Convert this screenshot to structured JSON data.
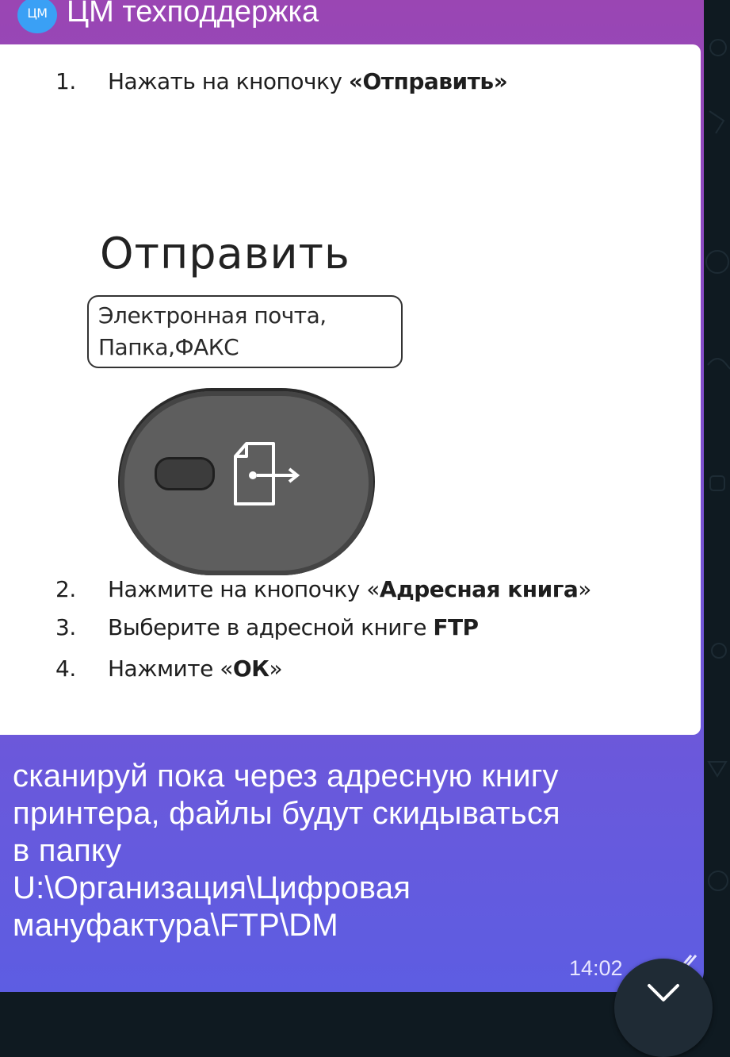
{
  "chat": {
    "sender_initials": "ЦМ",
    "sender_name": "ЦМ техподдержка"
  },
  "image": {
    "steps": [
      {
        "num": "1.",
        "text": "Нажать на кнопочку ",
        "bold": "«Отправить»"
      },
      {
        "num": "2.",
        "text": "Нажмите на кнопочку «",
        "bold": "Адресная книга",
        "tail": "»"
      },
      {
        "num": "3.",
        "text": "Выберите в адресной книге ",
        "bold": "FTP"
      },
      {
        "num": "4.",
        "text": "Нажмите «",
        "bold": "ОК",
        "tail": "»"
      }
    ],
    "button_title": "Отправить",
    "button_subtitle_line1": "Электронная почта,",
    "button_subtitle_line2": "Папка,ФАКС"
  },
  "message": {
    "lines": [
      "сканируй пока через адресную книгу",
      "принтера, файлы будут скидываться",
      "в папку",
      "U:\\Организация\\Цифровая",
      "мануфактура\\FTP\\DM"
    ],
    "time": "14:02"
  },
  "colors": {
    "bubble_top": "#9a46b3",
    "bubble_bottom": "#5d5de2",
    "avatar": "#3aa0f5",
    "background": "#0f1a21"
  },
  "icons": {
    "read_status": "double-check-icon",
    "scroll_down": "chevron-down-icon",
    "send_button": "document-send-icon"
  }
}
